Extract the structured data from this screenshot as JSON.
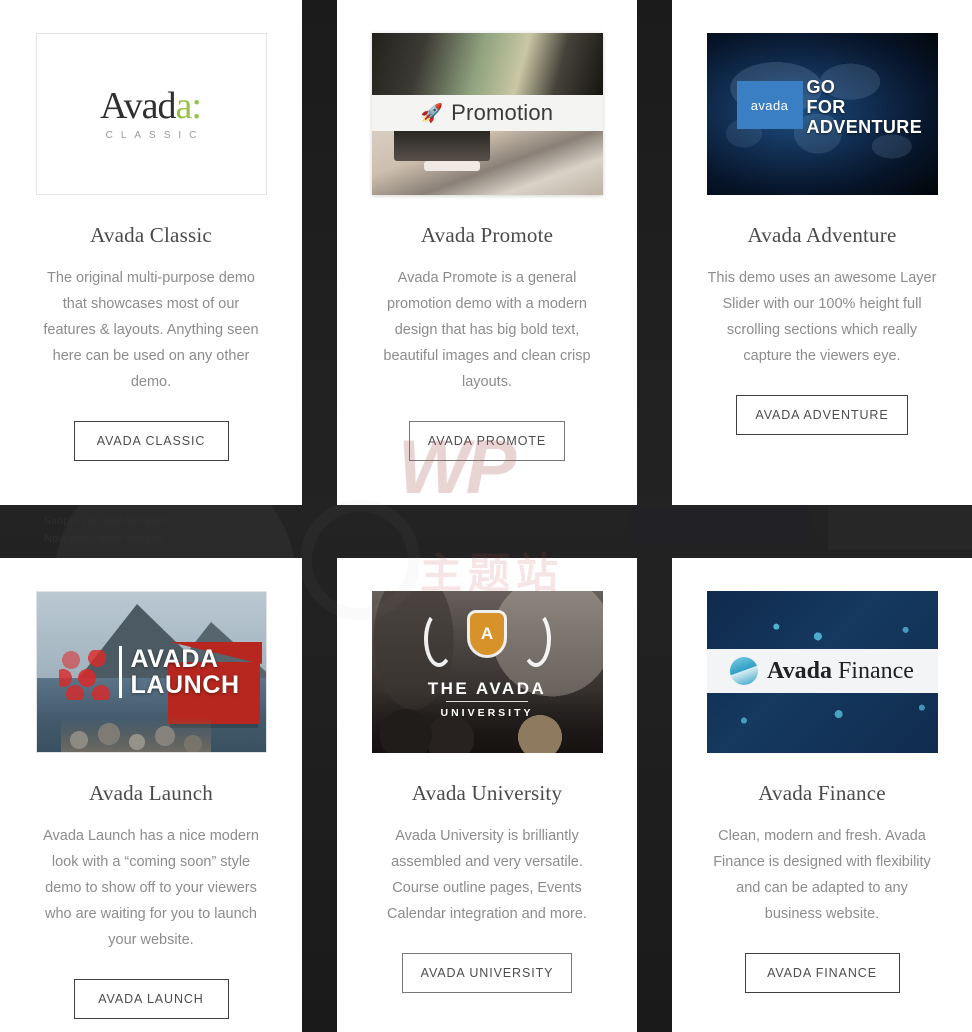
{
  "background": {
    "ghost_text_line1": "Simple yet sophisticated.",
    "ghost_text_line2": "Now even more flexible.",
    "watermark_primary": "WP",
    "watermark_secondary": "主题站"
  },
  "cards": [
    {
      "id": "avada-classic",
      "title": "Avada Classic",
      "description": "The original multi-purpose demo that showcases most of our features & layouts. Anything seen here can be used on any other demo.",
      "button_label": "AVADA CLASSIC",
      "thumb": {
        "kind": "logo",
        "logo_prefix": "Avad",
        "logo_accent": "a",
        "logo_colon": ":",
        "logo_sub": "CLASSIC",
        "accent_color": "#97c24a"
      }
    },
    {
      "id": "avada-promote",
      "title": "Avada Promote",
      "description": "Avada Promote is a general promotion demo with a modern design that has big bold text, beautiful images and clean crisp layouts.",
      "button_label": "AVADA PROMOTE",
      "thumb": {
        "kind": "photo-band",
        "band_text": "Promotion",
        "band_icon": "rocket-icon",
        "band_icon_glyph": "🚀"
      }
    },
    {
      "id": "avada-adventure",
      "title": "Avada Adventure",
      "description": "This demo uses an awesome Layer Slider with our 100% height full scrolling sections which really capture the viewers eye.",
      "button_label": "AVADA ADVENTURE",
      "thumb": {
        "kind": "dark-map",
        "badge_text": "avada",
        "slogan_line1": "GO",
        "slogan_line2": "FOR",
        "slogan_line3": "ADVENTURE",
        "badge_color": "#3a7fc4"
      }
    },
    {
      "id": "avada-launch",
      "title": "Avada Launch",
      "description": "Avada Launch has a nice modern look with a “coming soon” style demo to show off to your viewers who are waiting for you to launch your website.",
      "button_label": "AVADA LAUNCH",
      "thumb": {
        "kind": "landscape",
        "title_line1": "AVADA",
        "title_line2": "LAUNCH",
        "accent_color": "#dc2828"
      }
    },
    {
      "id": "avada-university",
      "title": "Avada University",
      "description": "Avada University is brilliantly assembled and very versatile. Course outline pages, Events Calendar integration and more.",
      "button_label": "AVADA UNIVERSITY",
      "thumb": {
        "kind": "classroom",
        "crest_letter": "A",
        "title_line1": "THE AVADA",
        "title_line2": "UNIVERSITY",
        "crest_color": "#d8922a"
      }
    },
    {
      "id": "avada-finance",
      "title": "Avada Finance",
      "description": "Clean, modern and fresh. Avada Finance is designed with flexibility and can be adapted to any business website.",
      "button_label": "AVADA FINANCE",
      "thumb": {
        "kind": "blue-band",
        "brand_bold": "Avada",
        "brand_light": "Finance",
        "accent_color": "#2f9fc4"
      }
    }
  ]
}
